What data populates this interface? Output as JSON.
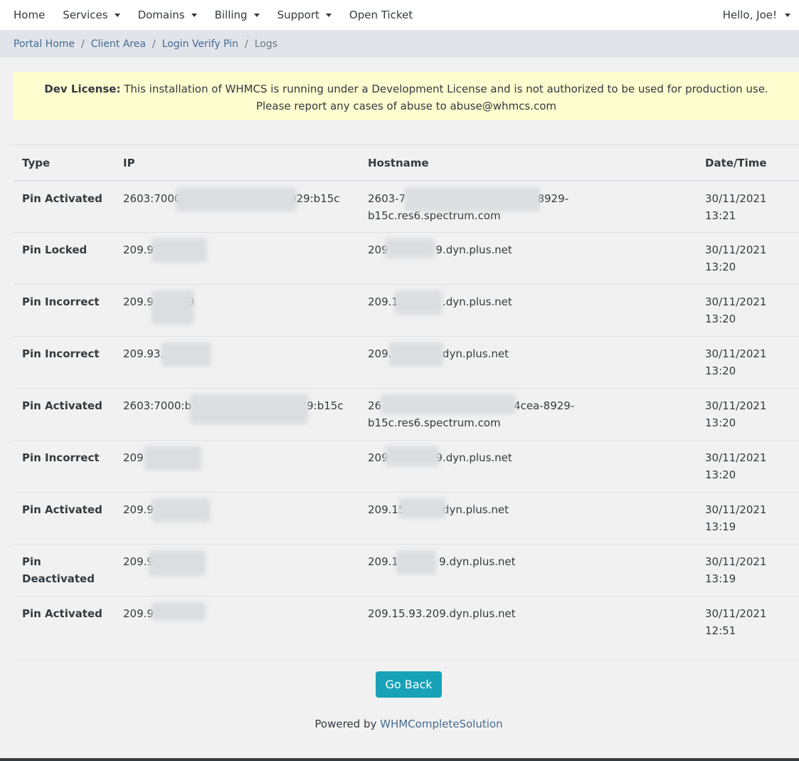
{
  "nav": {
    "items": [
      {
        "label": "Home",
        "dropdown": false
      },
      {
        "label": "Services",
        "dropdown": true
      },
      {
        "label": "Domains",
        "dropdown": true
      },
      {
        "label": "Billing",
        "dropdown": true
      },
      {
        "label": "Support",
        "dropdown": true
      },
      {
        "label": "Open Ticket",
        "dropdown": false
      }
    ],
    "user": "Hello, Joe!"
  },
  "breadcrumb": {
    "items": [
      "Portal Home",
      "Client Area",
      "Login Verify Pin"
    ],
    "active": "Logs",
    "separator": "/"
  },
  "license": {
    "label": "Dev License:",
    "message": "This installation of WHMCS is running under a Development License and is not authorized to be used for production use.",
    "message2": "Please report any cases of abuse to abuse@whmcs.com"
  },
  "table": {
    "headers": [
      "Type",
      "IP",
      "Hostname",
      "Date/Time"
    ],
    "rows": [
      {
        "type": "Pin Activated",
        "ip": "2603:7000                              8929:b15c",
        "hostname": "2603-7                         43-4cea-8929-b15c.res6.spectrum.com",
        "date": "30/11/2021",
        "time": "13:21"
      },
      {
        "type": "Pin Locked",
        "ip": "209.9",
        "hostname": "209              9.dyn.plus.net",
        "date": "30/11/2021",
        "time": "13:20"
      },
      {
        "type": "Pin Incorrect",
        "ip": "209.9          9",
        "hostname": "209.1             .dyn.plus.net",
        "date": "30/11/2021",
        "time": "13:20"
      },
      {
        "type": "Pin Incorrect",
        "ip": "209.93.",
        "hostname": "209.              .dyn.plus.net",
        "date": "30/11/2021",
        "time": "13:20"
      },
      {
        "type": "Pin Activated",
        "ip": "2603:7000:b7                              29:b15c",
        "hostname": "26                                       4cea-8929-b15c.res6.spectrum.com",
        "date": "30/11/2021",
        "time": "13:20"
      },
      {
        "type": "Pin Incorrect",
        "ip": "209",
        "hostname": "209              9.dyn.plus.net",
        "date": "30/11/2021",
        "time": "13:20"
      },
      {
        "type": "Pin Activated",
        "ip": "209.9",
        "hostname": "209.15           dyn.plus.net",
        "date": "30/11/2021",
        "time": "13:19"
      },
      {
        "type": "Pin Deactivated",
        "ip": "209.9",
        "hostname": "209.1            9.dyn.plus.net",
        "date": "30/11/2021",
        "time": "13:19"
      },
      {
        "type": "Pin Activated",
        "ip": "209.9",
        "hostname": "209.15.93.209.dyn.plus.net",
        "date": "30/11/2021",
        "time": "12:51"
      }
    ]
  },
  "actions": {
    "go_back": "Go Back"
  },
  "footer": {
    "prefix": "Powered by",
    "brand": "WHMCompleteSolution"
  },
  "colors": {
    "accent": "#17a2b8",
    "link": "#456a91",
    "banner": "#fefdd0"
  }
}
